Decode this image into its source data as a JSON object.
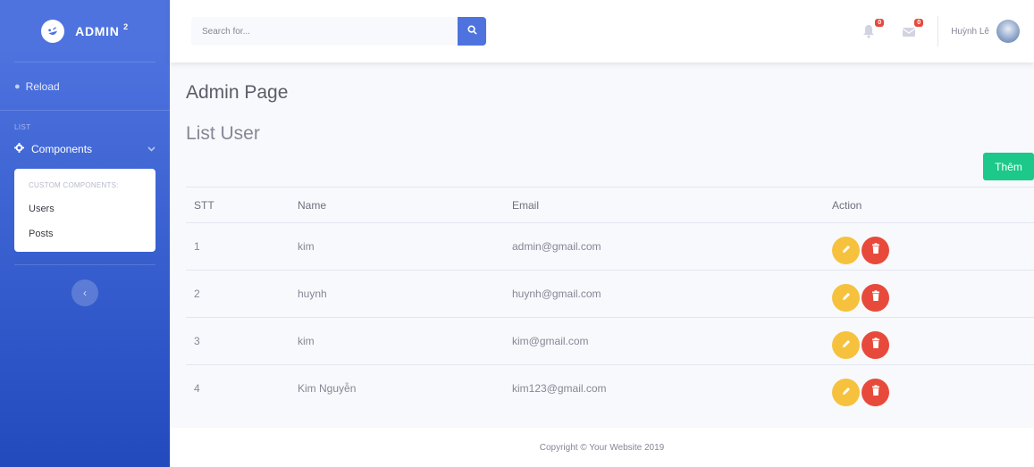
{
  "brand": {
    "name": "ADMIN",
    "sup": "2"
  },
  "sidebar": {
    "reload_label": "Reload",
    "heading": "LIST",
    "components_label": "Components",
    "collapse": {
      "header": "CUSTOM COMPONENTS:",
      "items": [
        {
          "label": "Users"
        },
        {
          "label": "Posts"
        }
      ]
    }
  },
  "topbar": {
    "search_placeholder": "Search for...",
    "alerts_count": "0",
    "messages_count": "0",
    "user_name": "Huỳnh Lê"
  },
  "main": {
    "page_title": "Admin Page",
    "section_title": "List User",
    "add_button": "Thêm",
    "table": {
      "headers": [
        "STT",
        "Name",
        "Email",
        "Action"
      ],
      "rows": [
        {
          "stt": "1",
          "name": "kim",
          "email": "admin@gmail.com"
        },
        {
          "stt": "2",
          "name": "huynh",
          "email": "huynh@gmail.com"
        },
        {
          "stt": "3",
          "name": "kim",
          "email": "kim@gmail.com"
        },
        {
          "stt": "4",
          "name": "Kim Nguyễn",
          "email": "kim123@gmail.com"
        }
      ]
    }
  },
  "footer": {
    "text": "Copyright © Your Website 2019"
  },
  "colors": {
    "primary": "#4e73df",
    "success": "#1cc88a",
    "warning": "#f6c23e",
    "danger": "#e74a3b"
  }
}
